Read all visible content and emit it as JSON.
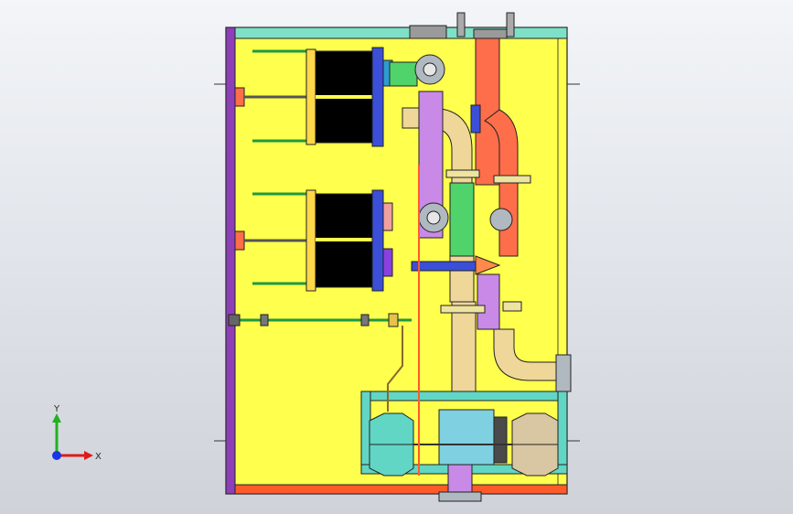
{
  "app": {
    "view": "cad-3d-viewport"
  },
  "triad": {
    "x_label": "X",
    "y_label": "Y",
    "colors": {
      "x": "#e11a1a",
      "y": "#23b021",
      "z": "#1a36e0"
    }
  },
  "model": {
    "colors": {
      "frame": "#ffff4d",
      "frame_edge": "#222222",
      "left_rail": "#8e3fb8",
      "bottom_rail": "#ff5a2a",
      "top_rail": "#7fe0c8",
      "tank": "#000000",
      "tank_flange": "#ffd84a",
      "pipe_orange": "#ff6e4a",
      "pipe_cream": "#efd79a",
      "pipe_purple": "#c88ae6",
      "pipe_green": "#4fd36a",
      "pipe_cyan": "#3ed8e0",
      "pipe_blue": "#6b4ee8",
      "pump_cyan": "#62d6c4",
      "pump_tan": "#d9c7a3",
      "rod": "#1e9a40"
    }
  }
}
